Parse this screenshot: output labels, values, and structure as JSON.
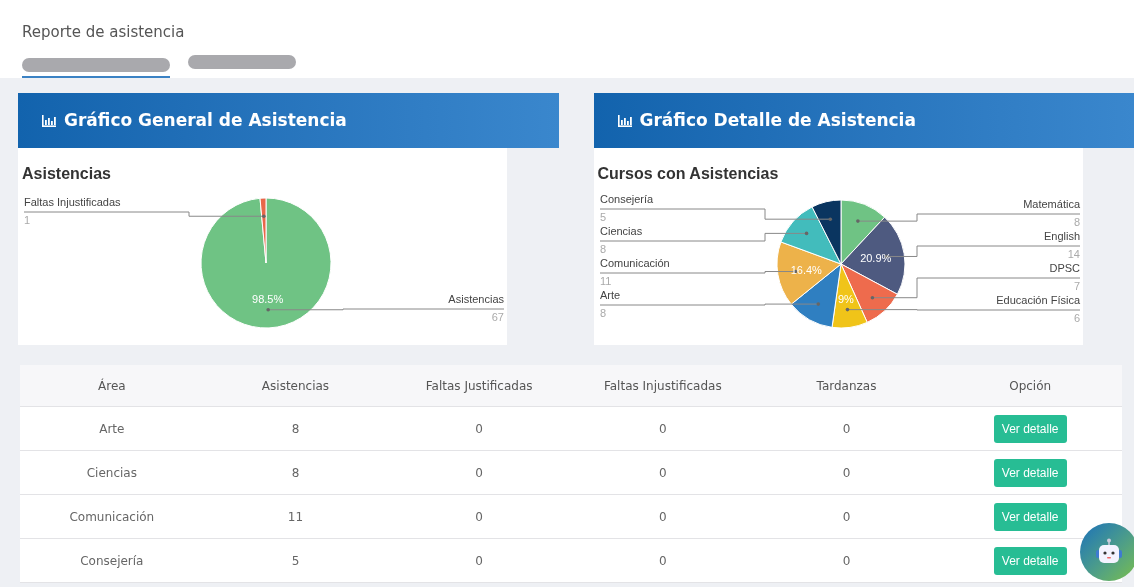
{
  "page": {
    "title": "Reporte de asistencia"
  },
  "tabs": [
    {
      "selected": true
    },
    {
      "selected": false
    }
  ],
  "charts": [
    {
      "header": "Gráfico General de Asistencia",
      "chart_data": {
        "type": "pie",
        "title": "Asistencias",
        "categories": [
          "Asistencias",
          "Faltas Injustificadas"
        ],
        "values": [
          67,
          1
        ],
        "data_labels": true,
        "colors": [
          "#6fc384",
          "#e8674a"
        ]
      },
      "slice_percent_labels": [
        {
          "shown": true,
          "text": "98.5%"
        },
        {
          "shown": false
        }
      ]
    },
    {
      "header": "Gráfico Detalle de Asistencia",
      "chart_data": {
        "type": "pie",
        "title": "Cursos con Asistencias",
        "categories": [
          "Matemática",
          "English",
          "DPSC",
          "Educación Física",
          "Arte",
          "Comunicación",
          "Ciencias",
          "Consejería"
        ],
        "values": [
          8,
          14,
          7,
          6,
          8,
          11,
          8,
          5
        ],
        "data_labels": true,
        "colors": [
          "#6fc384",
          "#4e5a80",
          "#ee6b4d",
          "#f0c419",
          "#2f7fc1",
          "#edb24a",
          "#42bcbc",
          "#0a3560"
        ]
      },
      "slice_percent_labels": [
        {
          "shown": false
        },
        {
          "shown": true,
          "text": "20.9%"
        },
        {
          "shown": false
        },
        {
          "shown": true,
          "text": "9%"
        },
        {
          "shown": false
        },
        {
          "shown": true,
          "text": "16.4%"
        },
        {
          "shown": false
        },
        {
          "shown": false
        }
      ]
    }
  ],
  "table": {
    "columns": [
      "Área",
      "Asistencias",
      "Faltas Justificadas",
      "Faltas Injustificadas",
      "Tardanzas",
      "Opción"
    ],
    "rows": [
      {
        "cells": [
          "Arte",
          "8",
          "0",
          "0",
          "0"
        ],
        "button": "Ver detalle"
      },
      {
        "cells": [
          "Ciencias",
          "8",
          "0",
          "0",
          "0"
        ],
        "button": "Ver detalle"
      },
      {
        "cells": [
          "Comunicación",
          "11",
          "0",
          "0",
          "0"
        ],
        "button": "Ver detalle"
      },
      {
        "cells": [
          "Consejería",
          "5",
          "0",
          "0",
          "0"
        ],
        "button": "Ver detalle"
      }
    ]
  },
  "chatbot": {
    "kind": "robot"
  }
}
